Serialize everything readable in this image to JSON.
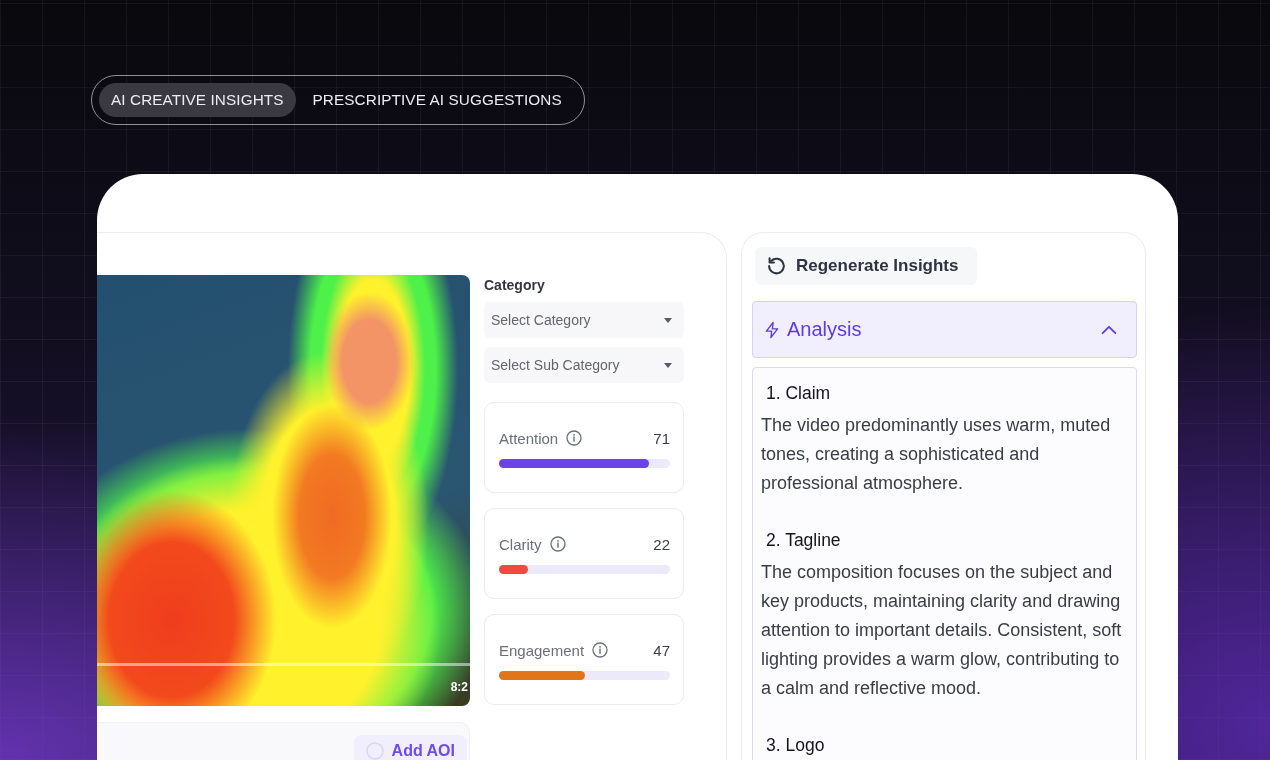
{
  "tabs": [
    {
      "label": "AI CREATIVE INSIGHTS",
      "selected": true
    },
    {
      "label": "PRESCRIPTIVE AI SUGGESTIONS",
      "selected": false
    }
  ],
  "video": {
    "timestamp": "8:2"
  },
  "aoi": {
    "button": "Add AOI"
  },
  "category": {
    "label": "Category",
    "selects": [
      {
        "placeholder": "Select Category"
      },
      {
        "placeholder": "Select Sub Category"
      }
    ]
  },
  "metrics": [
    {
      "name": "Attention",
      "value": "71",
      "level": 0.88,
      "color": "#6a42e8"
    },
    {
      "name": "Clarity",
      "value": "22",
      "level": 0.17,
      "color": "#ef4a3f"
    },
    {
      "name": "Engagement",
      "value": "47",
      "level": 0.5,
      "color": "#e2741a"
    }
  ],
  "insights": {
    "regenerate_button": "Regenerate Insights",
    "section": {
      "title": "Analysis",
      "expanded": true,
      "items": [
        {
          "heading": "1. Claim",
          "text": "The video predominantly uses warm, muted tones, creating a sophisticated and professional atmosphere."
        },
        {
          "heading": "2. Tagline",
          "text": "The composition focuses on the subject and key products, maintaining clarity and drawing attention to important details. Consistent, soft lighting provides a warm glow, contributing to a calm and reflective mood."
        },
        {
          "heading": "3. Logo"
        }
      ]
    }
  }
}
